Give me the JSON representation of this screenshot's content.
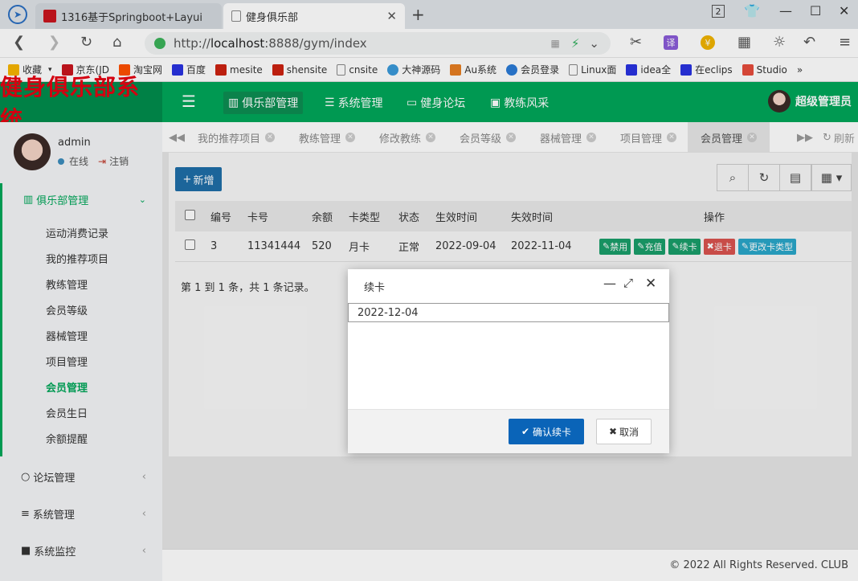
{
  "browser": {
    "tabs": [
      {
        "label": "1316基于Springboot+Layui",
        "active": false
      },
      {
        "label": "健身俱乐部",
        "active": true
      }
    ],
    "address": {
      "prefix": "http://",
      "host": "localhost",
      "rest": ":8888/gym/index"
    },
    "tab_badge": "2",
    "bookmarks": [
      {
        "label": "收藏",
        "color": "#f7b500"
      },
      {
        "label": "京东(JD",
        "color": "#c9151e"
      },
      {
        "label": "淘宝网",
        "color": "#ff5000"
      },
      {
        "label": "百度",
        "color": "#2932e1"
      },
      {
        "label": "mesite",
        "color": "#c21"
      },
      {
        "label": "shensite",
        "color": "#c21"
      },
      {
        "label": "cnsite",
        "color": "#888"
      },
      {
        "label": "大神源码",
        "color": "#3a9ad9"
      },
      {
        "label": "Au系统",
        "color": "#e67e22"
      },
      {
        "label": "会员登录",
        "color": "#2b7bd6"
      },
      {
        "label": "Linux面",
        "color": "#888"
      },
      {
        "label": "idea全",
        "color": "#2932e1"
      },
      {
        "label": "在eclips",
        "color": "#2932e1"
      },
      {
        "label": "Studio",
        "color": "#e74c3c"
      }
    ],
    "bookmark_more": "»"
  },
  "app": {
    "logo": "健身俱乐部系统",
    "topnav": [
      {
        "label": "俱乐部管理",
        "active": true,
        "icon": "chart-icon"
      },
      {
        "label": "系统管理",
        "active": false,
        "icon": "list-icon"
      },
      {
        "label": "健身论坛",
        "active": false,
        "icon": "card-icon"
      },
      {
        "label": "教练风采",
        "active": false,
        "icon": "image-icon"
      }
    ],
    "user_label": "超级管理员",
    "accent": "#00a65a",
    "logo_color": "#e60012"
  },
  "sidebar": {
    "username": "admin",
    "status_online": "在线",
    "logout": "注销",
    "group_open": "俱乐部管理",
    "sub_items": [
      {
        "label": "运动消费记录",
        "active": false
      },
      {
        "label": "我的推荐项目",
        "active": false
      },
      {
        "label": "教练管理",
        "active": false
      },
      {
        "label": "会员等级",
        "active": false
      },
      {
        "label": "器械管理",
        "active": false
      },
      {
        "label": "项目管理",
        "active": false
      },
      {
        "label": "会员管理",
        "active": true
      },
      {
        "label": "会员生日",
        "active": false
      },
      {
        "label": "余额提醒",
        "active": false
      }
    ],
    "groups": [
      {
        "label": "论坛管理",
        "icon": "circle-icon"
      },
      {
        "label": "系统管理",
        "icon": "bars-icon"
      },
      {
        "label": "系统监控",
        "icon": "video-icon"
      }
    ]
  },
  "content_tabs": {
    "items": [
      {
        "label": "我的推荐项目"
      },
      {
        "label": "教练管理"
      },
      {
        "label": "修改教练"
      },
      {
        "label": "会员等级"
      },
      {
        "label": "器械管理"
      },
      {
        "label": "项目管理"
      },
      {
        "label": "会员管理",
        "active": true
      }
    ],
    "refresh": "刷新"
  },
  "table": {
    "add_button": "新增",
    "headers": [
      "编号",
      "卡号",
      "余额",
      "卡类型",
      "状态",
      "生效时间",
      "失效时间",
      "操作"
    ],
    "rows": [
      {
        "id": "3",
        "card": "11341444",
        "balance": "520",
        "type": "月卡",
        "status": "正常",
        "start": "2022-09-04",
        "end": "2022-11-04"
      }
    ],
    "row_actions": [
      {
        "label": "禁用",
        "color": "#1a9e6a"
      },
      {
        "label": "充值",
        "color": "#1a9e6a"
      },
      {
        "label": "续卡",
        "color": "#1a9e6a"
      },
      {
        "label": "退卡",
        "color": "#d9534f"
      },
      {
        "label": "更改卡类型",
        "color": "#2aa7c9"
      }
    ],
    "pager": "第 1 到 1 条，共 1 条记录。"
  },
  "footer": "© 2022 All Rights Reserved. CLUB",
  "modal": {
    "title": "续卡",
    "date_value": "2022-12-04",
    "confirm": "确认续卡",
    "cancel": "取消"
  }
}
